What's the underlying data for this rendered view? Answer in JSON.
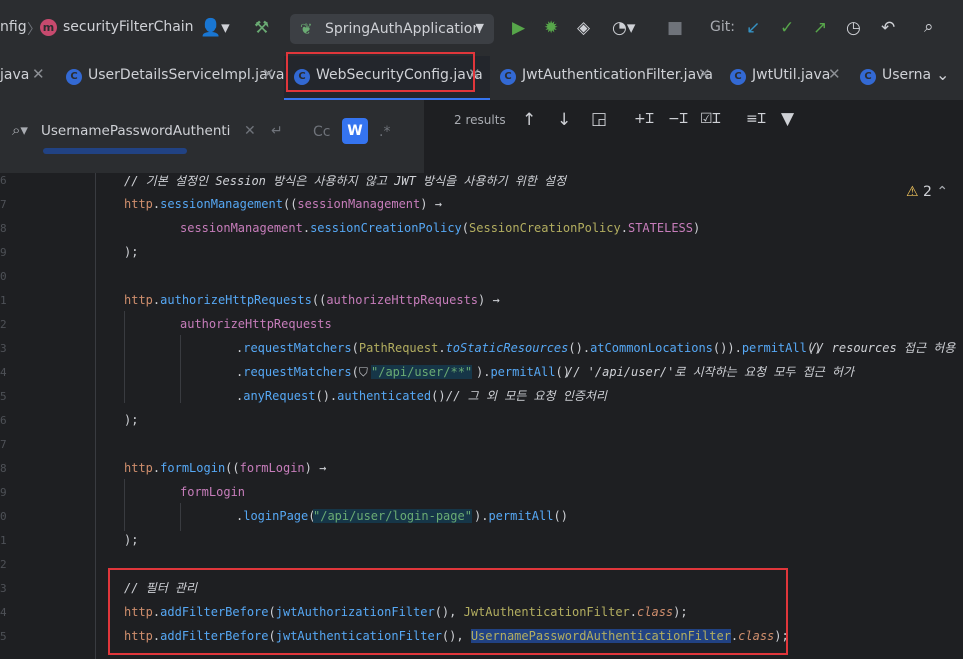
{
  "nav": {
    "crumb_left": "nfig",
    "method_badge": "m",
    "method_name": "securityFilterChain",
    "run_config": "SpringAuthApplication",
    "git_label": "Git:"
  },
  "icons": {
    "user": "user-dropdown-icon",
    "hammer": "build-hammer-icon",
    "run": "run-icon",
    "debug": "debug-icon",
    "coverage": "coverage-icon",
    "profile": "profile-icon",
    "stop": "stop-icon",
    "git_update": "git-update-icon",
    "git_commit": "git-commit-icon",
    "git_push": "git-push-icon",
    "history": "history-icon",
    "undo": "undo-icon",
    "search": "search-icon"
  },
  "tabs": [
    {
      "label": "java"
    },
    {
      "label": "UserDetailsServiceImpl.java"
    },
    {
      "label": "WebSecurityConfig.java"
    },
    {
      "label": "JwtAuthenticationFilter.java"
    },
    {
      "label": "JwtUtil.java"
    },
    {
      "label": "Userna"
    }
  ],
  "find": {
    "query": "UsernamePasswordAuthentication",
    "cc": "Cc",
    "w": "W",
    "regex": ".*",
    "results": "2 results"
  },
  "editor": {
    "warnings": "2",
    "line_numbers": [
      "6",
      "7",
      "8",
      "9",
      "0",
      "1",
      "2",
      "3",
      "4",
      "5",
      "6",
      "7",
      "8",
      "9",
      "0",
      "1",
      "2",
      "3",
      "4",
      "5"
    ],
    "lines": {
      "c1": "// 기본 설정인 Session 방식은 사용하지 않고 JWT 방식을 사용하기 위한 설정",
      "c2": "// resources 접근 허용",
      "c3": "// '/api/user/'로 시작하는 요청 모두 접근 허가",
      "c4": "// 그 외 모든 요청 인증처리",
      "c5": "// 필터 관리",
      "s1": "\"/api/user/**\"",
      "s2": "\"/api/user/login-page\""
    }
  },
  "colors": {
    "highlight": "#e0363b",
    "accent": "#3574f0"
  }
}
